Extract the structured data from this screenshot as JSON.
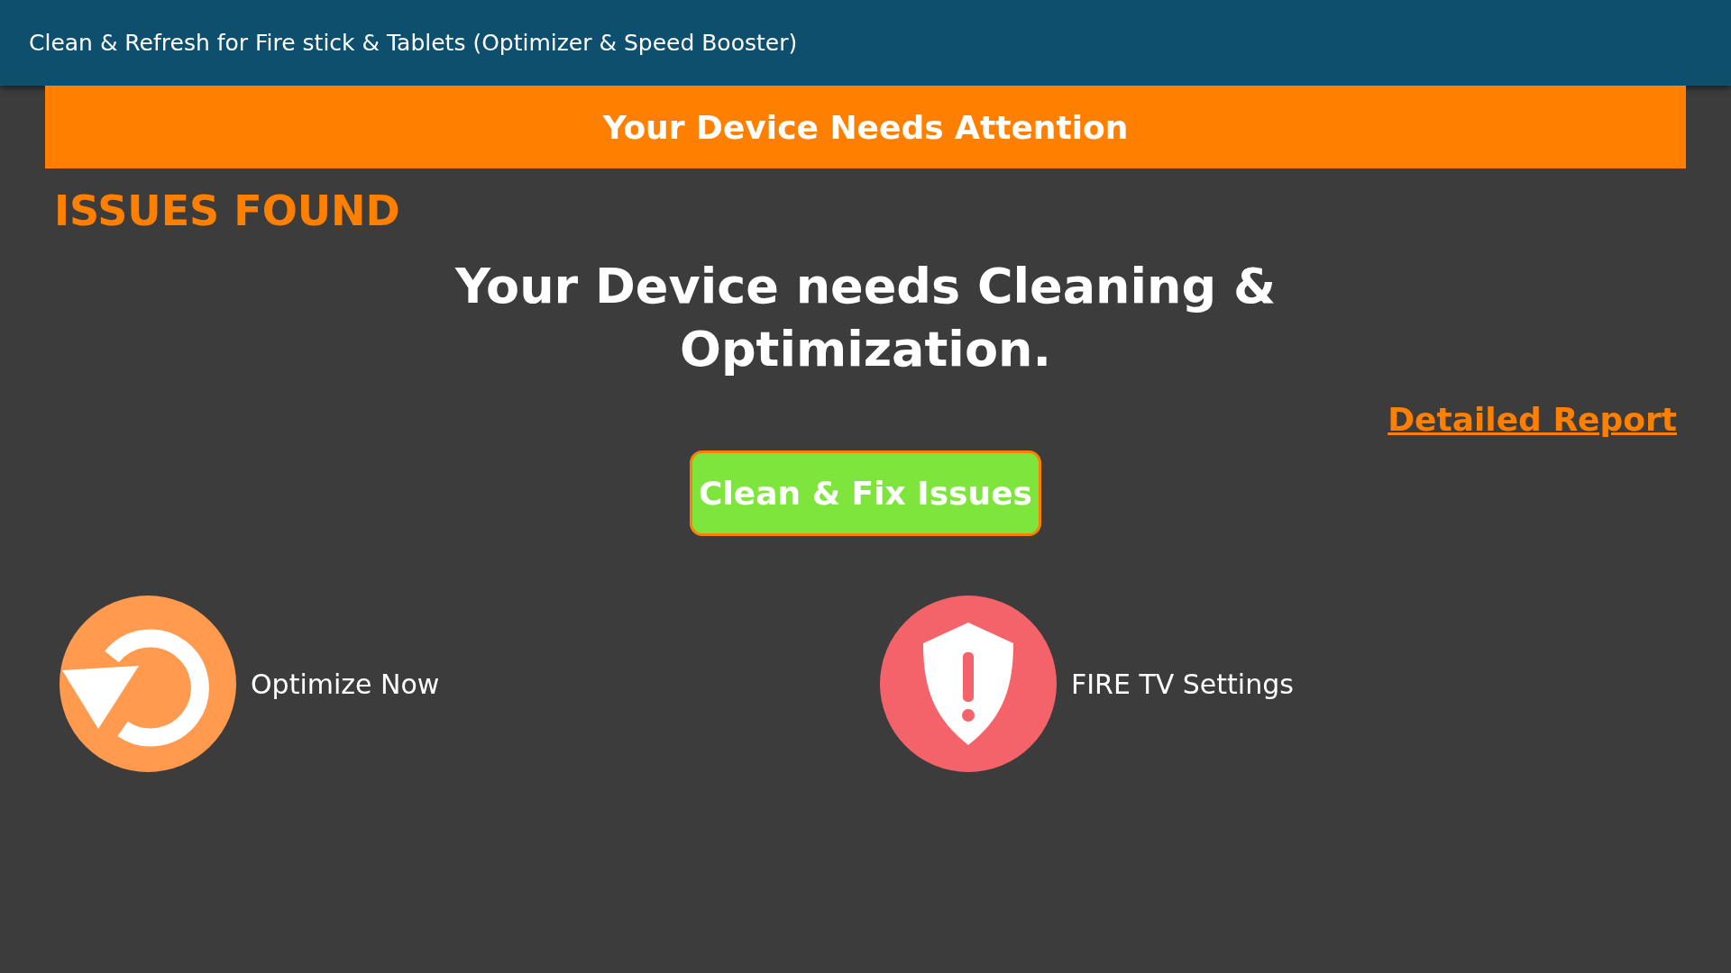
{
  "window": {
    "title": "Clean & Refresh for Fire stick & Tablets (Optimizer & Speed Booster)"
  },
  "banner": "Your Device Needs Attention",
  "issues_heading": "ISSUES FOUND",
  "message": "Your Device needs Cleaning & Optimization.",
  "report_link": "Detailed Report",
  "action_button": "Clean & Fix Issues",
  "shortcuts": [
    {
      "kind": "optimize",
      "label": "Optimize Now"
    },
    {
      "kind": "shield",
      "label": "FIRE TV Settings"
    }
  ]
}
